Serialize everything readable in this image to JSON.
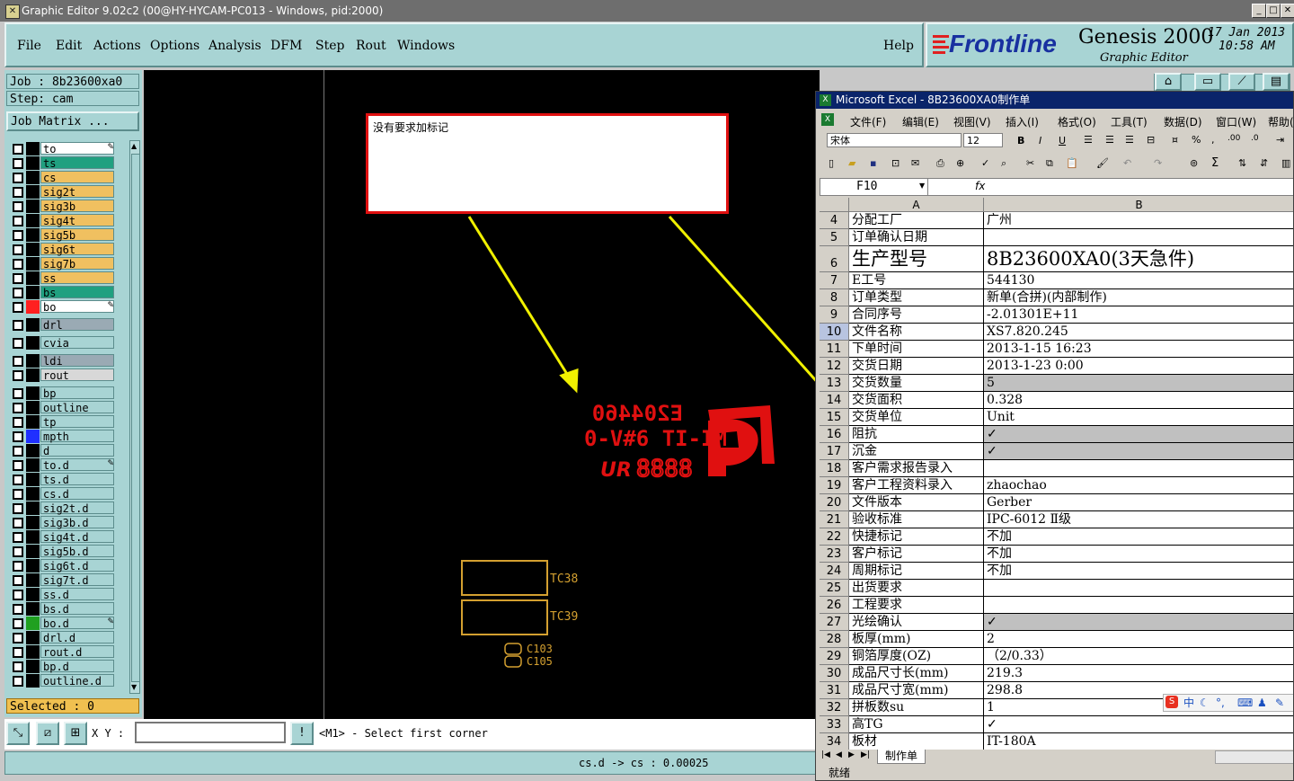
{
  "genesis": {
    "title": "Graphic Editor 9.02c2 (00@HY-HYCAM-PC013 - Windows, pid:2000)",
    "menu": [
      "File",
      "Edit",
      "Actions",
      "Options",
      "Analysis",
      "DFM",
      "Step",
      "Rout",
      "Windows"
    ],
    "help": "Help",
    "brand": "Frontline",
    "product": "Genesis 2000",
    "subtitle": "Graphic Editor",
    "date": "17 Jan 2013",
    "time": "10:58 AM",
    "job": "Job : 8b23600xa0",
    "step": "Step: cam",
    "job_matrix": "Job Matrix ...",
    "selected": "Selected : 0",
    "xy_label": "X Y :",
    "prompt": "<M1> - Select first corner",
    "status": "cs.d -> cs : 0.00025",
    "layers": [
      {
        "name": "to",
        "color": "#ffffff",
        "icon": "edit"
      },
      {
        "name": "ts",
        "color": "#20a080"
      },
      {
        "name": "cs",
        "color": "#f0c060"
      },
      {
        "name": "sig2t",
        "color": "#f0c060"
      },
      {
        "name": "sig3b",
        "color": "#f0c060"
      },
      {
        "name": "sig4t",
        "color": "#f0c060"
      },
      {
        "name": "sig5b",
        "color": "#f0c060"
      },
      {
        "name": "sig6t",
        "color": "#f0c060"
      },
      {
        "name": "sig7b",
        "color": "#f0c060"
      },
      {
        "name": "ss",
        "color": "#f0c060"
      },
      {
        "name": "bs",
        "color": "#20a080"
      },
      {
        "name": "bo",
        "color": "#ffffff",
        "swatch": "#ff2020",
        "icon": "edit"
      },
      {
        "name": "drl",
        "color": "#9aaab4"
      },
      {
        "name": "cvia",
        "color": "#a8d4d4"
      },
      {
        "name": "ldi",
        "color": "#9aaab4"
      },
      {
        "name": "rout",
        "color": "#d8d8d8"
      },
      {
        "name": "bp",
        "color": "#a8d4d4"
      },
      {
        "name": "outline",
        "color": "#a8d4d4"
      },
      {
        "name": "tp",
        "color": "#a8d4d4"
      },
      {
        "name": "mpth",
        "color": "#a8d4d4",
        "swatch": "#2030ff"
      },
      {
        "name": "d",
        "color": "#a8d4d4"
      },
      {
        "name": "to.d",
        "color": "#a8d4d4",
        "icon": "edit"
      },
      {
        "name": "ts.d",
        "color": "#a8d4d4"
      },
      {
        "name": "cs.d",
        "color": "#a8d4d4"
      },
      {
        "name": "sig2t.d",
        "color": "#a8d4d4"
      },
      {
        "name": "sig3b.d",
        "color": "#a8d4d4"
      },
      {
        "name": "sig4t.d",
        "color": "#a8d4d4"
      },
      {
        "name": "sig5b.d",
        "color": "#a8d4d4"
      },
      {
        "name": "sig6t.d",
        "color": "#a8d4d4"
      },
      {
        "name": "sig7t.d",
        "color": "#a8d4d4"
      },
      {
        "name": "ss.d",
        "color": "#a8d4d4"
      },
      {
        "name": "bs.d",
        "color": "#a8d4d4"
      },
      {
        "name": "bo.d",
        "color": "#a8d4d4",
        "swatch": "#20a020",
        "icon": "edit"
      },
      {
        "name": "drl.d",
        "color": "#a8d4d4"
      },
      {
        "name": "rout.d",
        "color": "#a8d4d4"
      },
      {
        "name": "bp.d",
        "color": "#a8d4d4"
      },
      {
        "name": "outline.d",
        "color": "#a8d4d4"
      }
    ],
    "note": "没有要求加标记",
    "board_text": {
      "line1": "E204460",
      "line2": "0-V#6 TI-IM",
      "line3": "8888",
      "ur": "UR",
      "tc38": "TC38",
      "tc39": "TC39",
      "c103": "C103",
      "c105": "C105"
    }
  },
  "excel": {
    "title": "Microsoft Excel - 8B23600XA0制作单",
    "menu": [
      "文件(F)",
      "编辑(E)",
      "视图(V)",
      "插入(I)",
      "格式(O)",
      "工具(T)",
      "数据(D)",
      "窗口(W)",
      "帮助("
    ],
    "font": "宋体",
    "font_size": "12",
    "cell_ref": "F10",
    "fx": "fx",
    "col_a": "A",
    "col_b": "B",
    "sheet_tab": "制作单",
    "status": "就绪",
    "rows": [
      {
        "n": "4",
        "a": "分配工厂",
        "b": "广州"
      },
      {
        "n": "5",
        "a": "订单确认日期",
        "b": ""
      },
      {
        "n": "6",
        "a": "生产型号",
        "b": "8B23600XA0(3天急件)",
        "big": true
      },
      {
        "n": "7",
        "a": "E工号",
        "b": "544130"
      },
      {
        "n": "8",
        "a": "订单类型",
        "b": "新单(合拼)(内部制作)"
      },
      {
        "n": "9",
        "a": "合同序号",
        "b": "-2.01301E+11"
      },
      {
        "n": "10",
        "a": "文件名称",
        "b": "XS7.820.245",
        "sel": true
      },
      {
        "n": "11",
        "a": "下单时间",
        "b": "2013-1-15 16:23"
      },
      {
        "n": "12",
        "a": "交货日期",
        "b": "2013-1-23 0:00"
      },
      {
        "n": "13",
        "a": "交货数量",
        "b": "5",
        "gray": true
      },
      {
        "n": "14",
        "a": "交货面积",
        "b": "0.328"
      },
      {
        "n": "15",
        "a": "交货单位",
        "b": "Unit"
      },
      {
        "n": "16",
        "a": "阻抗",
        "b": "✓",
        "gray": true
      },
      {
        "n": "17",
        "a": "沉金",
        "b": "✓",
        "gray": true
      },
      {
        "n": "18",
        "a": "客户需求报告录入",
        "b": ""
      },
      {
        "n": "19",
        "a": "客户工程资料录入",
        "b": "zhaochao"
      },
      {
        "n": "20",
        "a": "文件版本",
        "b": "Gerber"
      },
      {
        "n": "21",
        "a": "验收标准",
        "b": "IPC-6012 Ⅱ级"
      },
      {
        "n": "22",
        "a": "快捷标记",
        "b": "不加"
      },
      {
        "n": "23",
        "a": "客户标记",
        "b": "不加"
      },
      {
        "n": "24",
        "a": "周期标记",
        "b": "不加"
      },
      {
        "n": "25",
        "a": "出货要求",
        "b": ""
      },
      {
        "n": "26",
        "a": "工程要求",
        "b": ""
      },
      {
        "n": "27",
        "a": "光绘确认",
        "b": "✓",
        "gray": true
      },
      {
        "n": "28",
        "a": "板厚(mm)",
        "b": "2"
      },
      {
        "n": "29",
        "a": "铜箔厚度(OZ)",
        "b": "（2/0.33）"
      },
      {
        "n": "30",
        "a": "成品尺寸长(mm)",
        "b": "219.3"
      },
      {
        "n": "31",
        "a": "成品尺寸宽(mm)",
        "b": "298.8"
      },
      {
        "n": "32",
        "a": "拼板数su",
        "b": "1"
      },
      {
        "n": "33",
        "a": "高TG",
        "b": "✓"
      },
      {
        "n": "34",
        "a": "板材",
        "b": "IT-180A"
      }
    ],
    "ime": "中"
  }
}
